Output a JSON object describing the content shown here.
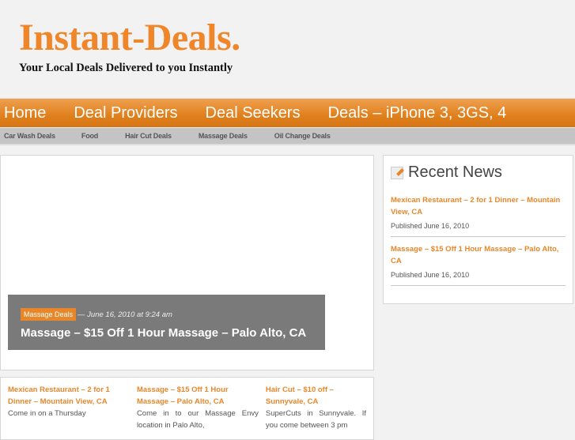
{
  "header": {
    "logo": "Instant-Deals.",
    "tagline": "Your Local Deals Delivered to you Instantly"
  },
  "nav": [
    "Home",
    "Deal Providers",
    "Deal Seekers",
    "Deals – iPhone 3, 3GS, 4"
  ],
  "subnav": [
    "Car Wash Deals",
    "Food",
    "Hair Cut Deals",
    "Massage Deals",
    "Oil Change Deals"
  ],
  "feature": {
    "category": "Massage Deals",
    "date": "— June 16, 2010 at 9:24 am",
    "title": "Massage – $15 Off 1 Hour Massage – Palo Alto, CA"
  },
  "sidebar": {
    "title": "Recent News",
    "items": [
      {
        "title": "Mexican Restaurant – 2 for 1 Dinner – Mountain View, CA",
        "date": "Published June 16, 2010"
      },
      {
        "title": "Massage – $15 Off 1 Hour Massage – Palo Alto, CA",
        "date": "Published June 16, 2010"
      }
    ]
  },
  "posts": [
    {
      "title": "Mexican Restaurant – 2 for 1 Dinner – Mountain View, CA",
      "excerpt": "Come in on a Thursday"
    },
    {
      "title": "Massage – $15 Off 1 Hour Massage – Palo Alto, CA",
      "excerpt": "Come in to our Massage Envy location in Palo Alto,"
    },
    {
      "title": "Hair Cut – $10 off – Sunnyvale, CA",
      "excerpt": "SuperCuts in Sunnyvale. If you come between 3 pm"
    }
  ]
}
